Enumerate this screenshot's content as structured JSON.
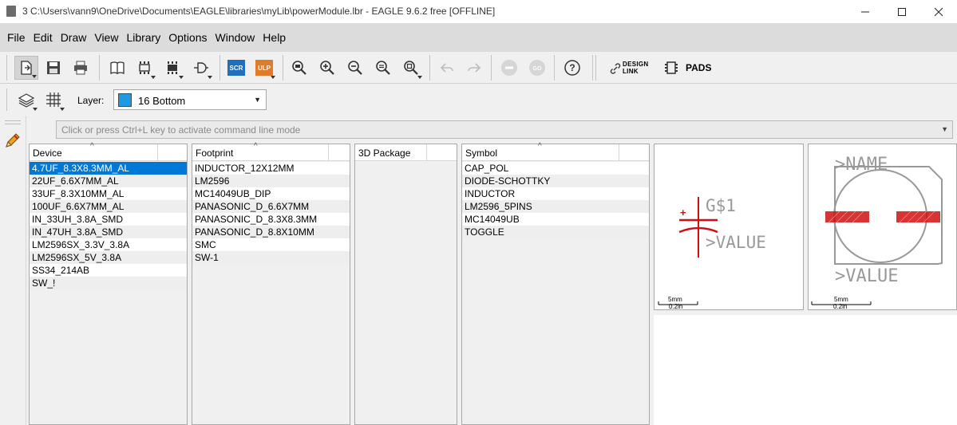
{
  "window": {
    "title": "3 C:\\Users\\vann9\\OneDrive\\Documents\\EAGLE\\libraries\\myLib\\powerModule.lbr - EAGLE 9.6.2 free [OFFLINE]"
  },
  "menu": [
    "File",
    "Edit",
    "Draw",
    "View",
    "Library",
    "Options",
    "Window",
    "Help"
  ],
  "toolbar": {
    "scr_label": "SCR",
    "ulp_label": "ULP",
    "design_link_line1": "DESIGN",
    "design_link_line2": "LINK",
    "pads_label": "PADS",
    "colors": {
      "scr": "#1e6fc0",
      "ulp": "#e07b2a",
      "selection": "#0078d7",
      "red": "#d01010"
    }
  },
  "layer": {
    "label": "Layer:",
    "selected": "16 Bottom",
    "color": "#1e9be0"
  },
  "command_line": {
    "placeholder": "Click or press Ctrl+L key to activate command line mode"
  },
  "device_panel": {
    "header": "Device",
    "items": [
      "4.7UF_8.3X8.3MM_AL",
      "22UF_6.6X7MM_AL",
      "33UF_8.3X10MM_AL",
      "100UF_6.6X7MM_AL",
      "IN_33UH_3.8A_SMD",
      "IN_47UH_3.8A_SMD",
      "LM2596SX_3.3V_3.8A",
      "LM2596SX_5V_3.8A",
      "SS34_214AB",
      "SW_!"
    ],
    "selected_index": 0
  },
  "footprint_panel": {
    "header": "Footprint",
    "items": [
      "INDUCTOR_12X12MM",
      "LM2596",
      "MC14049UB_DIP",
      "PANASONIC_D_6.6X7MM",
      "PANASONIC_D_8.3X8.3MM",
      "PANASONIC_D_8.8X10MM",
      "SMC",
      "SW-1"
    ]
  },
  "package_panel": {
    "header": "3D Package",
    "items": []
  },
  "symbol_panel": {
    "header": "Symbol",
    "items": [
      "CAP_POL",
      "DIODE-SCHOTTKY",
      "INDUCTOR",
      "LM2596_5PINS",
      "MC14049UB",
      "TOGGLE"
    ]
  },
  "symbol_preview": {
    "name_text": "G$1",
    "value_text": ">VALUE",
    "plus_text": "+",
    "scale_mm": "5mm",
    "scale_in": "0.2in"
  },
  "footprint_preview": {
    "name_text": ">NAME",
    "value_text": ">VALUE",
    "scale_mm": "5mm",
    "scale_in": "0.2in"
  }
}
